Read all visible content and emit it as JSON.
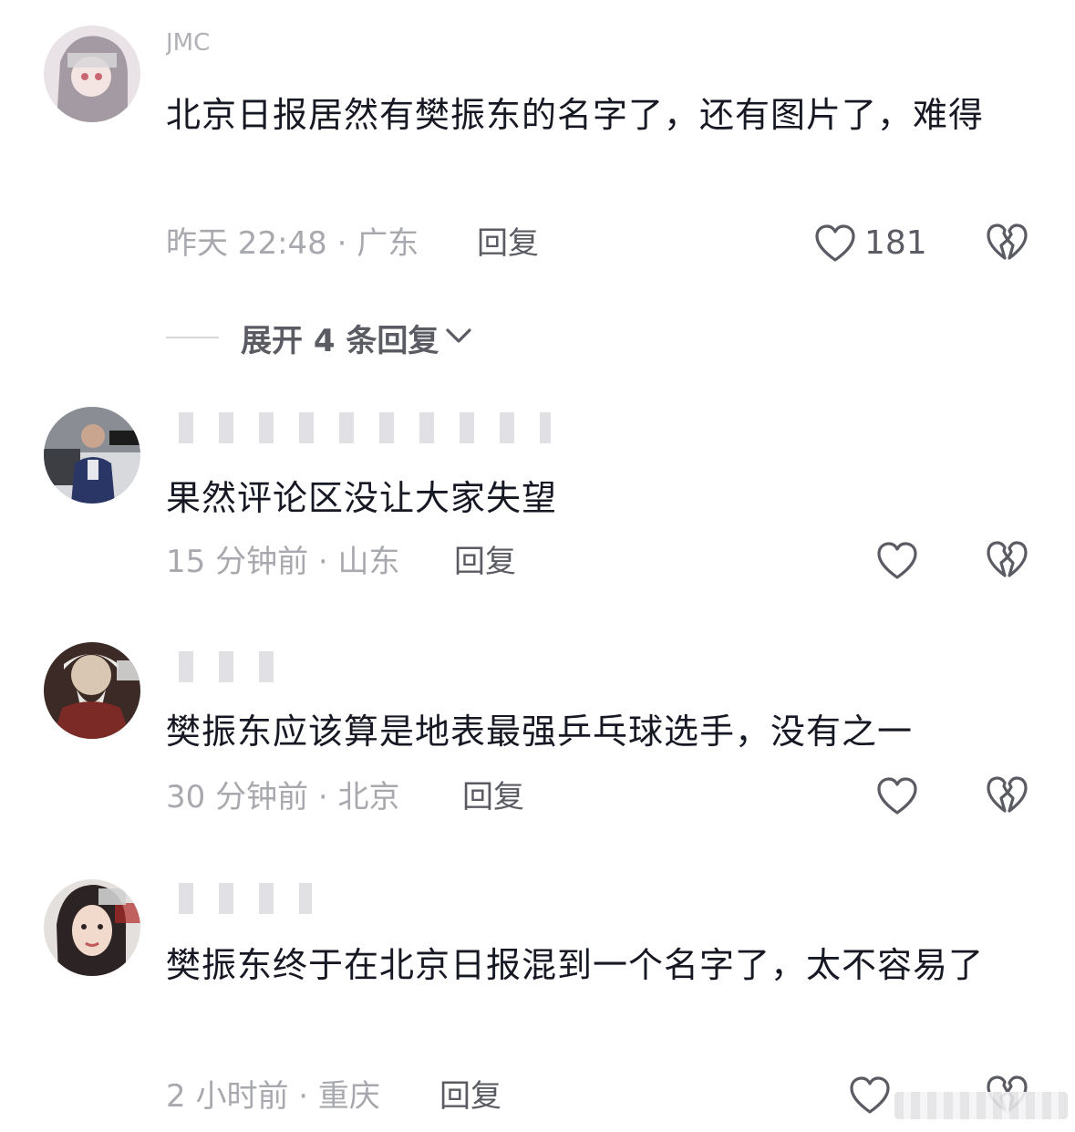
{
  "comments": [
    {
      "username": "JMC",
      "text": "北京日报居然有樊振东的名字了，还有图片了，难得",
      "meta": "昨天 22:48 · 广东",
      "reply_label": "回复",
      "like_count": "181"
    },
    {
      "username": "",
      "text": "果然评论区没让大家失望",
      "meta": "15 分钟前 · 山东",
      "reply_label": "回复",
      "like_count": ""
    },
    {
      "username": "",
      "text": "樊振东应该算是地表最强乒乓球选手，没有之一",
      "meta": "30 分钟前 · 北京",
      "reply_label": "回复",
      "like_count": ""
    },
    {
      "username": "",
      "text": "樊振东终于在北京日报混到一个名字了，太不容易了",
      "meta": "2 小时前 · 重庆",
      "reply_label": "回复",
      "like_count": ""
    }
  ],
  "expand_replies": {
    "label": "展开 4 条回复"
  },
  "colors": {
    "text_primary": "#161823",
    "text_secondary": "#a8a9ae",
    "action_text": "#5b5c63",
    "icon_stroke": "#5b5c63"
  },
  "icons": {
    "like": "heart-outline-icon",
    "dislike": "broken-heart-icon",
    "expand": "chevron-down-icon"
  }
}
